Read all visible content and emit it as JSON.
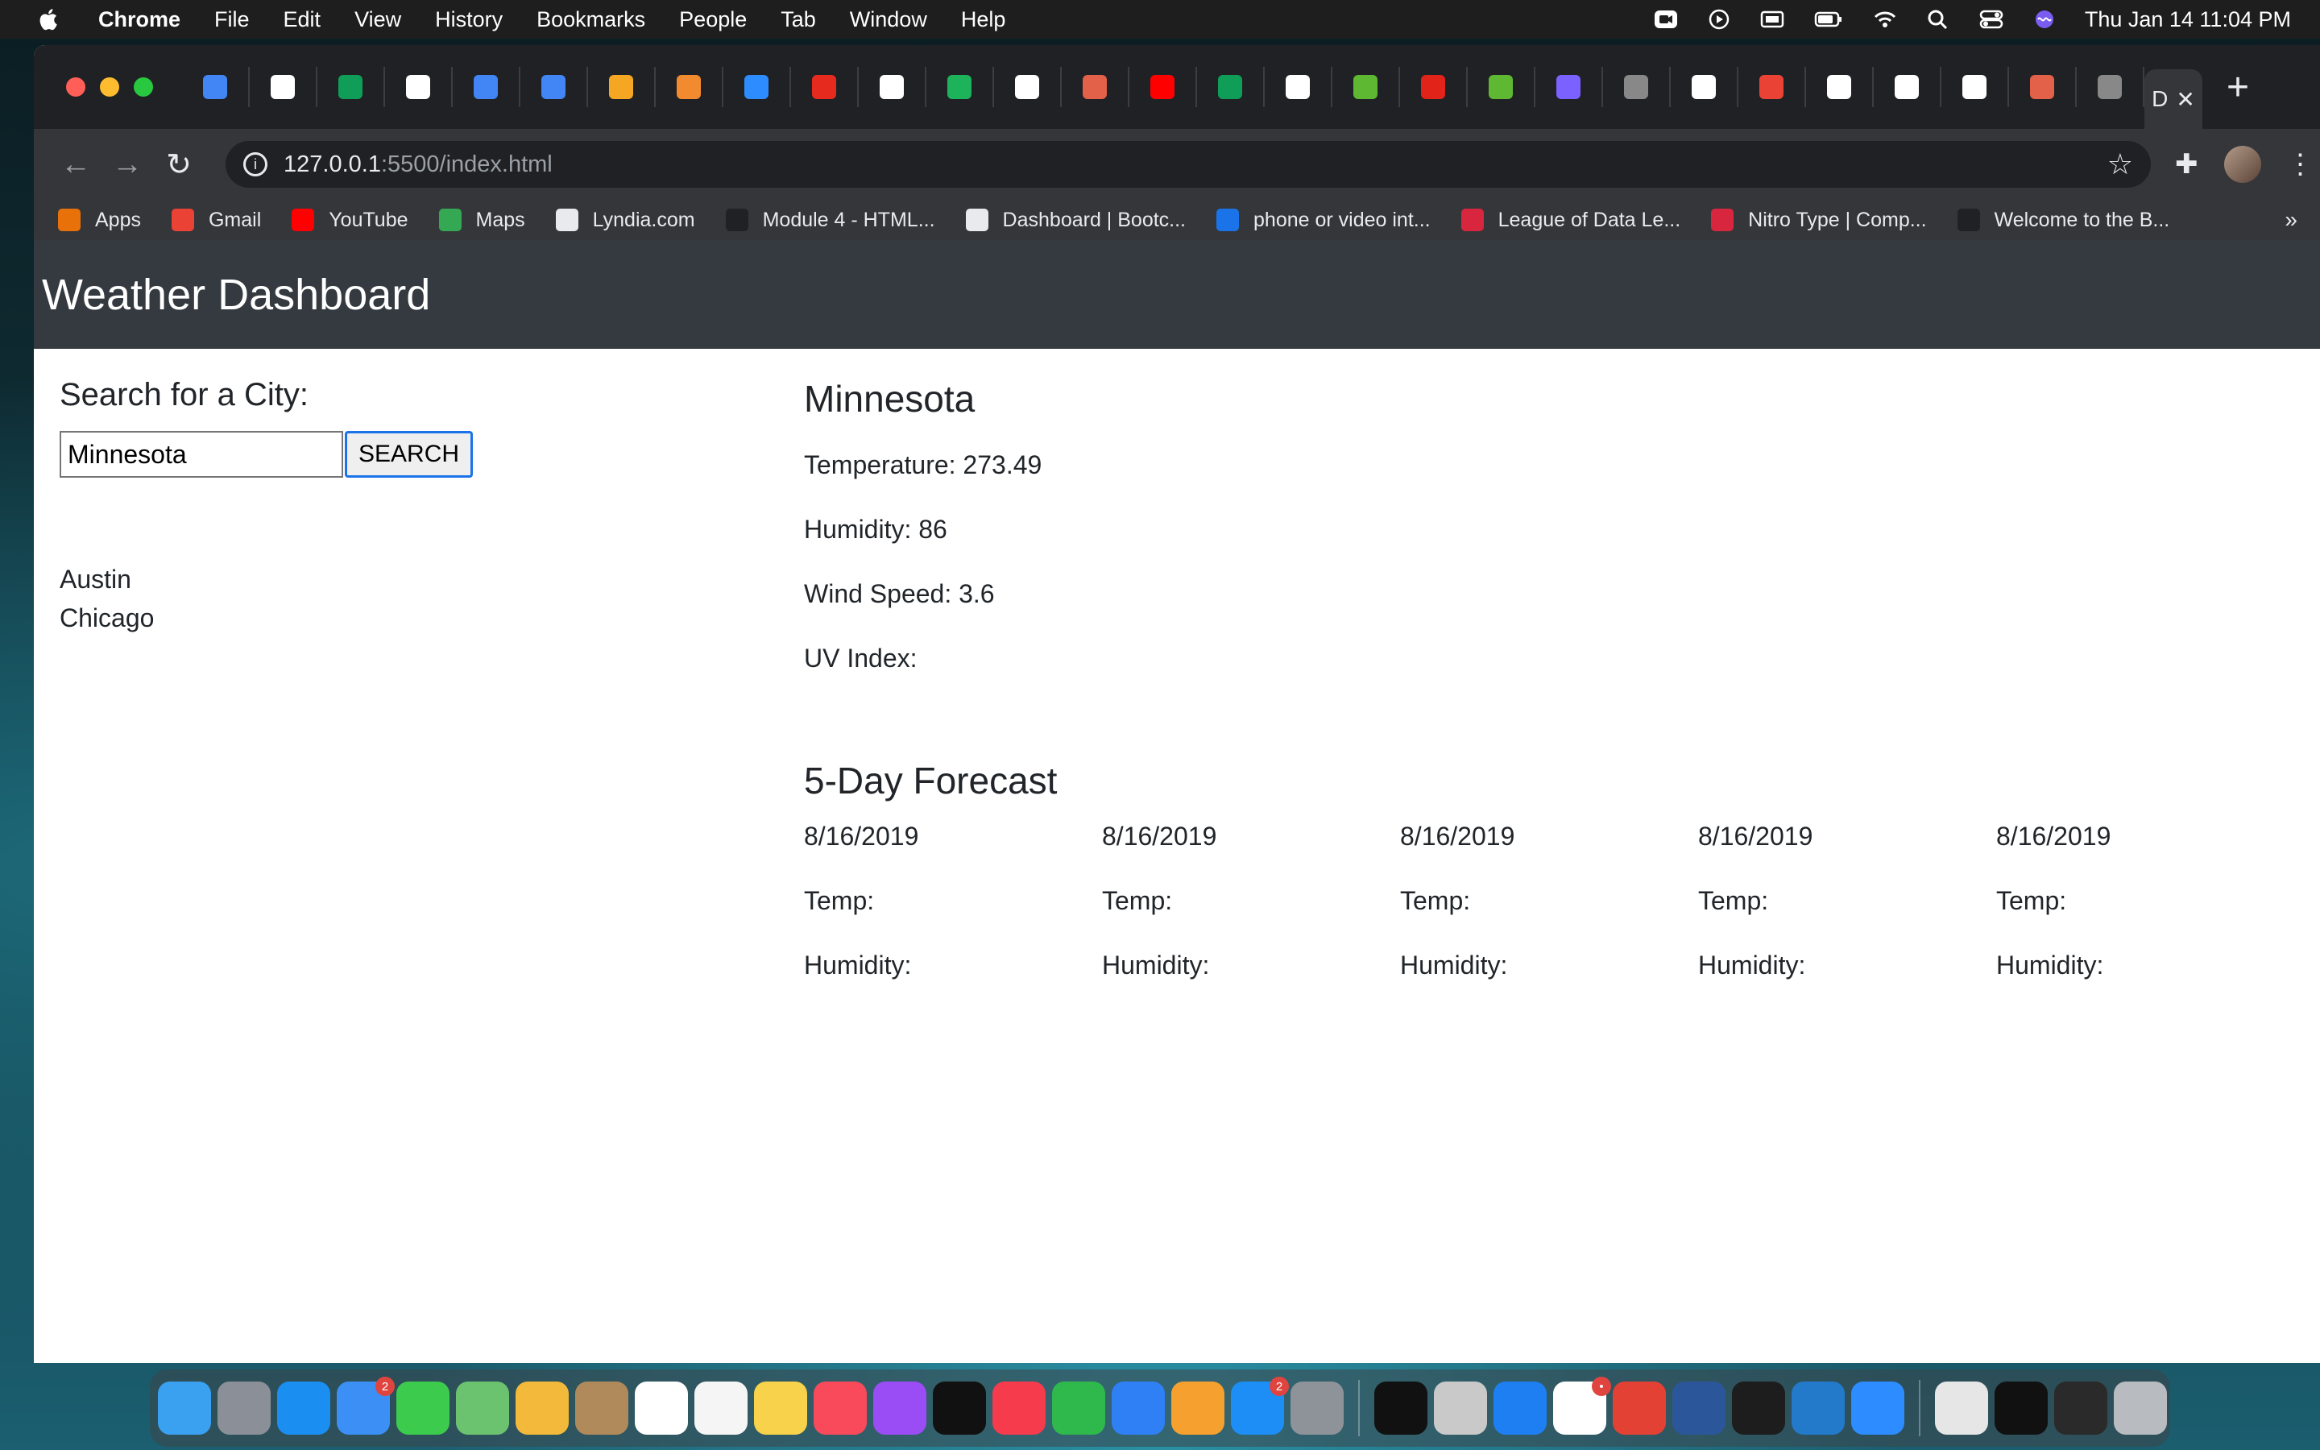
{
  "menubar": {
    "app": "Chrome",
    "items": [
      "File",
      "Edit",
      "View",
      "History",
      "Bookmarks",
      "People",
      "Tab",
      "Window",
      "Help"
    ],
    "clock": "Thu Jan 14  11:04 PM"
  },
  "browser": {
    "url_host": "127.0.0.1",
    "url_path": ":5500/index.html",
    "active_tab_label": "D",
    "tab_favicon_colors": [
      "#4285f4",
      "#ffffff",
      "#0f9d58",
      "#ffffff",
      "#4285f4",
      "#4285f4",
      "#f5a623",
      "#f28b30",
      "#2d8cff",
      "#e62b1e",
      "#ffffff",
      "#1cb35b",
      "#ffffff",
      "#e36049",
      "#ff0000",
      "#0f9d58",
      "#ffffff",
      "#5fb832",
      "#e2231a",
      "#5fb832",
      "#7b61ff",
      "#888888",
      "#ffffff",
      "#ea4335",
      "#ffffff",
      "#ffffff",
      "#ffffff",
      "#e36049",
      "#888888"
    ],
    "bookmarks": [
      {
        "label": "Apps",
        "color": "#e8710a"
      },
      {
        "label": "Gmail",
        "color": "#ea4335"
      },
      {
        "label": "YouTube",
        "color": "#ff0000"
      },
      {
        "label": "Maps",
        "color": "#34a853"
      },
      {
        "label": "Lyndia.com",
        "color": "#e8eaed"
      },
      {
        "label": "Module 4 - HTML...",
        "color": "#202124"
      },
      {
        "label": "Dashboard | Bootc...",
        "color": "#e8eaed"
      },
      {
        "label": "phone or video int...",
        "color": "#1a73e8"
      },
      {
        "label": "League of Data Le...",
        "color": "#d7263d"
      },
      {
        "label": "Nitro Type | Comp...",
        "color": "#d7263d"
      },
      {
        "label": "Welcome to the B...",
        "color": "#202124"
      }
    ],
    "bookmarks_more": "»"
  },
  "app": {
    "title": "Weather Dashboard",
    "search": {
      "label": "Search for a City:",
      "value": "Minnesota",
      "button": "SEARCH"
    },
    "history": [
      "Austin",
      "Chicago"
    ],
    "current": {
      "city": "Minnesota",
      "temperature": "Temperature: 273.49",
      "humidity": "Humidity: 86",
      "wind": "Wind Speed: 3.6",
      "uv": "UV Index:"
    },
    "forecast_title": "5-Day Forecast",
    "forecast": [
      {
        "date": "8/16/2019",
        "temp": "Temp:",
        "humidity": "Humidity:"
      },
      {
        "date": "8/16/2019",
        "temp": "Temp:",
        "humidity": "Humidity:"
      },
      {
        "date": "8/16/2019",
        "temp": "Temp:",
        "humidity": "Humidity:"
      },
      {
        "date": "8/16/2019",
        "temp": "Temp:",
        "humidity": "Humidity:"
      },
      {
        "date": "8/16/2019",
        "temp": "Temp:",
        "humidity": "Humidity:"
      }
    ]
  },
  "dock": {
    "apps": [
      {
        "name": "finder-icon",
        "color": "#3aa0f0"
      },
      {
        "name": "launchpad-icon",
        "color": "#8a8f98"
      },
      {
        "name": "safari-icon",
        "color": "#1b8ef2"
      },
      {
        "name": "mail-icon",
        "color": "#3b8ff5",
        "badge": "2"
      },
      {
        "name": "messages-icon",
        "color": "#3ccb4d"
      },
      {
        "name": "maps-icon",
        "color": "#6cc36f"
      },
      {
        "name": "photos-icon",
        "color": "#f3b93a"
      },
      {
        "name": "contacts-icon",
        "color": "#b08a5a"
      },
      {
        "name": "calendar-icon",
        "color": "#ffffff"
      },
      {
        "name": "reminders-icon",
        "color": "#f5f5f5"
      },
      {
        "name": "notes-icon",
        "color": "#f7d24a"
      },
      {
        "name": "music-icon",
        "color": "#f84a5b"
      },
      {
        "name": "podcasts-icon",
        "color": "#9b4df5"
      },
      {
        "name": "tv-icon",
        "color": "#111111"
      },
      {
        "name": "news-icon",
        "color": "#f53b4c"
      },
      {
        "name": "numbers-icon",
        "color": "#2fb84c"
      },
      {
        "name": "keynote-icon",
        "color": "#2f7ff5"
      },
      {
        "name": "pages-icon",
        "color": "#f5a02f"
      },
      {
        "name": "app-store-icon",
        "color": "#1c8ef5",
        "badge": "2"
      },
      {
        "name": "system-preferences-icon",
        "color": "#8e9399"
      },
      {
        "name": "terminal-icon",
        "color": "#111111"
      },
      {
        "name": "chess-icon",
        "color": "#c9c9c9"
      },
      {
        "name": "xcode-icon",
        "color": "#1d7ff2"
      },
      {
        "name": "slack-icon",
        "color": "#ffffff",
        "badge": "•"
      },
      {
        "name": "chrome-icon",
        "color": "#e34133"
      },
      {
        "name": "word-icon",
        "color": "#2b579a"
      },
      {
        "name": "activity-monitor-icon",
        "color": "#1d1d1d"
      },
      {
        "name": "vscode-icon",
        "color": "#2379ca"
      },
      {
        "name": "zoom-icon",
        "color": "#2d8cff"
      },
      {
        "name": "archive-icon",
        "color": "#e6e6e6"
      },
      {
        "name": "window-preview-icon",
        "color": "#111111"
      },
      {
        "name": "window-preview-icon-2",
        "color": "#2a2a2a"
      },
      {
        "name": "trash-icon",
        "color": "#b8bcc0"
      }
    ]
  }
}
